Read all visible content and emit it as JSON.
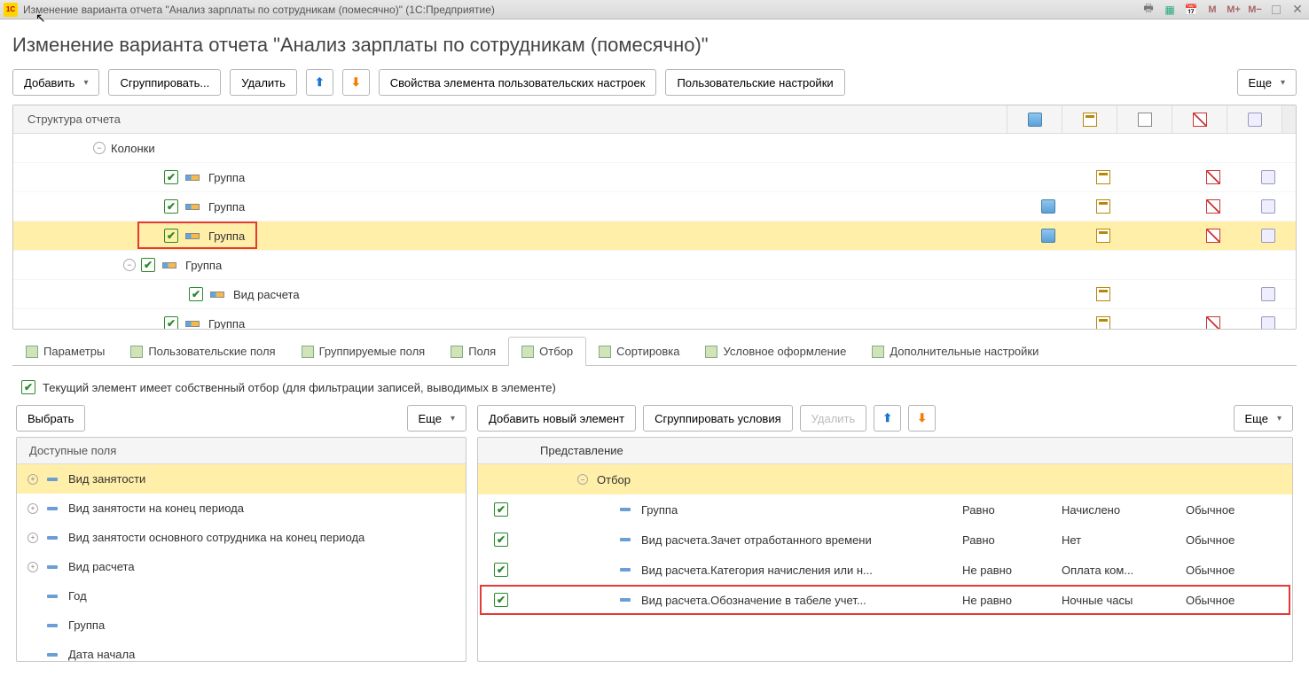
{
  "titlebar": {
    "app": "1C",
    "title": "Изменение варианта отчета \"Анализ зарплаты по сотрудникам (помесячно)\"  (1С:Предприятие)"
  },
  "heading": "Изменение варианта отчета \"Анализ зарплаты по сотрудникам (помесячно)\"",
  "toolbar": {
    "add": "Добавить",
    "group": "Сгруппировать...",
    "delete": "Удалить",
    "props": "Свойства элемента пользовательских настроек",
    "usersettings": "Пользовательские настройки",
    "more": "Еще"
  },
  "structure": {
    "header": "Структура отчета",
    "rows": [
      {
        "indent": 80,
        "exp": "−",
        "check": false,
        "tag": false,
        "text": "Колонки",
        "cells": [
          null,
          null,
          null,
          null,
          null
        ]
      },
      {
        "indent": 140,
        "exp": "",
        "check": true,
        "tag": true,
        "text": "Группа",
        "cells": [
          null,
          "t",
          null,
          "red",
          "gear"
        ]
      },
      {
        "indent": 140,
        "exp": "",
        "check": true,
        "tag": true,
        "text": "Группа",
        "cells": [
          "db",
          "t",
          null,
          "red",
          "gear"
        ]
      },
      {
        "indent": 140,
        "exp": "",
        "check": true,
        "tag": true,
        "text": "Группа",
        "cells": [
          "db",
          "t",
          null,
          "red",
          "gear"
        ],
        "selected": true,
        "redbox": true
      },
      {
        "indent": 114,
        "exp": "−",
        "check": true,
        "tag": true,
        "text": "Группа",
        "cells": [
          null,
          null,
          null,
          null,
          null
        ]
      },
      {
        "indent": 168,
        "exp": "",
        "check": true,
        "tag": true,
        "text": "Вид расчета",
        "cells": [
          null,
          "t",
          null,
          null,
          "gear"
        ]
      },
      {
        "indent": 140,
        "exp": "",
        "check": true,
        "tag": true,
        "text": "Группа",
        "cells": [
          null,
          "t",
          null,
          "red",
          "gear"
        ]
      }
    ]
  },
  "tabs": {
    "items": [
      {
        "label": "Параметры"
      },
      {
        "label": "Пользовательские поля"
      },
      {
        "label": "Группируемые поля"
      },
      {
        "label": "Поля"
      },
      {
        "label": "Отбор",
        "active": true
      },
      {
        "label": "Сортировка"
      },
      {
        "label": "Условное оформление"
      },
      {
        "label": "Дополнительные настройки"
      }
    ]
  },
  "ownfilter": "Текущий элемент имеет собственный отбор (для фильтрации записей, выводимых в элементе)",
  "left": {
    "choose": "Выбрать",
    "more": "Еще",
    "header": "Доступные поля",
    "fields": [
      {
        "exp": "+",
        "text": "Вид занятости",
        "hl": true
      },
      {
        "exp": "+",
        "text": "Вид занятости на конец периода"
      },
      {
        "exp": "+",
        "text": "Вид занятости основного сотрудника на конец периода"
      },
      {
        "exp": "+",
        "text": "Вид расчета"
      },
      {
        "exp": "",
        "text": "Год"
      },
      {
        "exp": "",
        "text": "Группа"
      },
      {
        "exp": "",
        "text": "Дата начала"
      }
    ]
  },
  "right": {
    "addnew": "Добавить новый элемент",
    "groupcond": "Сгруппировать условия",
    "delete": "Удалить",
    "more": "Еще",
    "header": "Представление",
    "rows": [
      {
        "check": false,
        "exp": "−",
        "text": "Отбор",
        "hl": true
      },
      {
        "check": true,
        "dash": true,
        "text": "Группа",
        "t": "Равно",
        "v": "Начислено",
        "m": "Обычное"
      },
      {
        "check": true,
        "dash": true,
        "text": "Вид расчета.Зачет отработанного времени",
        "t": "Равно",
        "v": "Нет",
        "m": "Обычное"
      },
      {
        "check": true,
        "dash": true,
        "text": "Вид расчета.Категория начисления или н...",
        "t": "Не равно",
        "v": "Оплата ком...",
        "m": "Обычное"
      },
      {
        "check": true,
        "dash": true,
        "text": "Вид расчета.Обозначение в табеле учет...",
        "t": "Не равно",
        "v": "Ночные часы",
        "m": "Обычное",
        "redbox": true
      }
    ]
  }
}
